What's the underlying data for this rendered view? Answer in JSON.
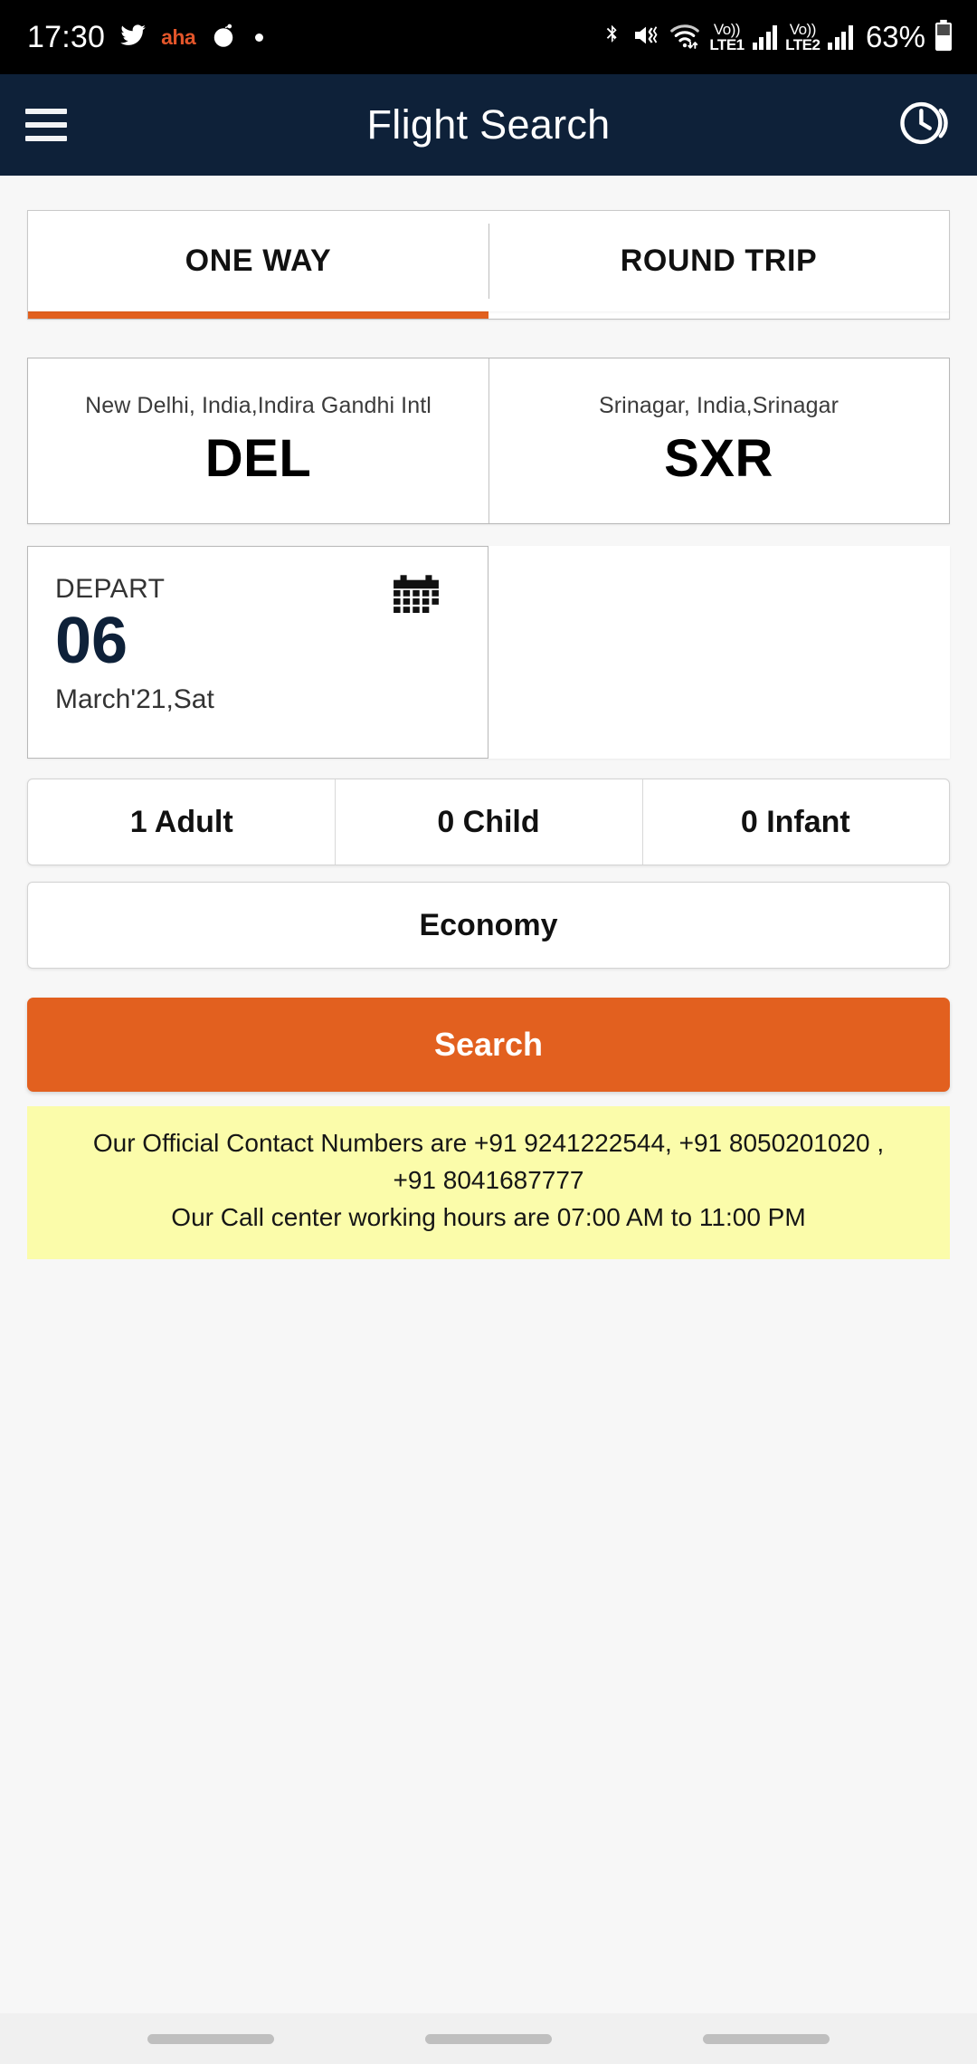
{
  "status_bar": {
    "time": "17:30",
    "battery_percent": "63%",
    "icons": [
      "twitter-icon",
      "aha-app-icon",
      "reddit-icon",
      "notification-dot",
      "bluetooth-icon",
      "vibrate-mute-icon",
      "wifi-icon",
      "volte-sim1-icon",
      "signal-sim1-icon",
      "volte-sim2-icon",
      "signal-sim2-icon",
      "battery-icon"
    ],
    "aha_label": "aha",
    "sim1_label_top": "Vo))",
    "sim1_label_bottom": "LTE1",
    "sim2_label_top": "Vo))",
    "sim2_label_bottom": "LTE2"
  },
  "app_bar": {
    "title": "Flight Search",
    "menu_icon": "hamburger-menu-icon",
    "history_icon": "booking-history-clock-icon",
    "background_color": "#0e2139"
  },
  "tabs": [
    {
      "label": "ONE WAY",
      "active": true
    },
    {
      "label": "ROUND TRIP",
      "active": false
    }
  ],
  "airports": {
    "origin": {
      "city": "New Delhi, India,Indira Gandhi Intl",
      "code": "DEL"
    },
    "destination": {
      "city": "Srinagar, India,Srinagar",
      "code": "SXR"
    }
  },
  "dates": {
    "depart": {
      "label": "DEPART",
      "day": "06",
      "month_year_weekday": "March'21,Sat",
      "calendar_icon": "calendar-icon"
    },
    "return": {
      "label": "",
      "day": "",
      "month_year_weekday": ""
    }
  },
  "passengers": [
    {
      "label": "1 Adult"
    },
    {
      "label": "0 Child"
    },
    {
      "label": "0 Infant"
    }
  ],
  "travel_class": {
    "label": "Economy"
  },
  "search": {
    "label": "Search",
    "accent_color": "#e2601f"
  },
  "notice": {
    "background_color": "#fbfcaa",
    "lines": [
      "Our Official Contact Numbers are +91 9241222544, +91 8050201020 ,",
      "+91 8041687777",
      "Our Call center working hours are 07:00 AM to 11:00 PM"
    ]
  },
  "nav_bar": {
    "pills": [
      "recents-pill",
      "home-pill",
      "back-pill"
    ]
  }
}
